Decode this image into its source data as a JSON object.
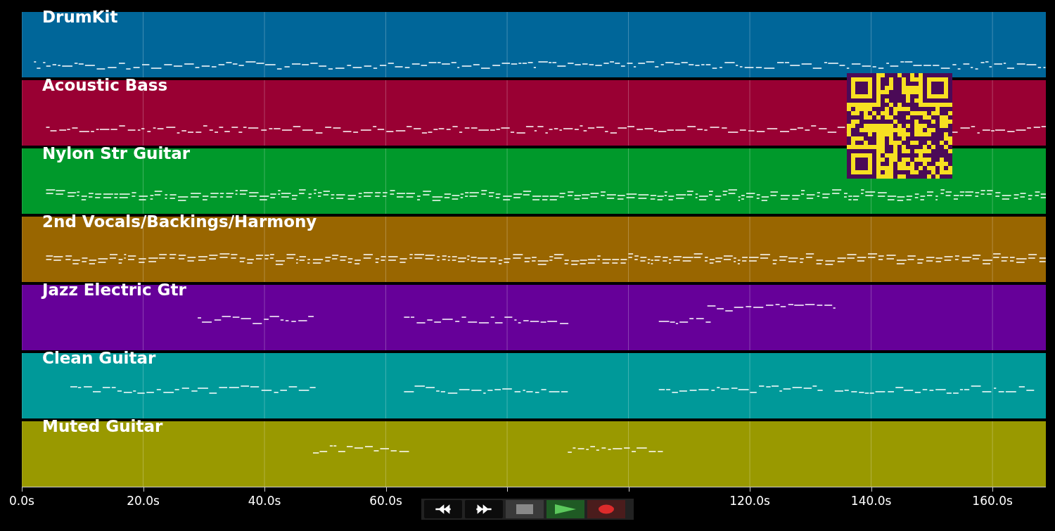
{
  "tracks": [
    {
      "name": "DrumKit",
      "color": "#006699"
    },
    {
      "name": "Acoustic Bass",
      "color": "#990033"
    },
    {
      "name": "Nylon Str Guitar",
      "color": "#00992b"
    },
    {
      "name": "2nd Vocals/Backings/Harmony",
      "color": "#996600"
    },
    {
      "name": "Jazz Electric Gtr",
      "color": "#660099"
    },
    {
      "name": "Clean Guitar",
      "color": "#009999"
    },
    {
      "name": "Muted Guitar",
      "color": "#999900"
    }
  ],
  "x_axis": {
    "ticks": [
      {
        "label": "0.0s"
      },
      {
        "label": "20.0s"
      },
      {
        "label": "40.0s"
      },
      {
        "label": "60.0s"
      },
      {
        "covered": true
      },
      {
        "covered": true
      },
      {
        "label": "120.0s"
      },
      {
        "label": "140.0s"
      },
      {
        "label": "160.0s"
      }
    ]
  },
  "transport": [
    {
      "kind": "rewind"
    },
    {
      "kind": "forward"
    },
    {
      "kind": "stop"
    },
    {
      "kind": "play"
    },
    {
      "kind": "record"
    }
  ]
}
